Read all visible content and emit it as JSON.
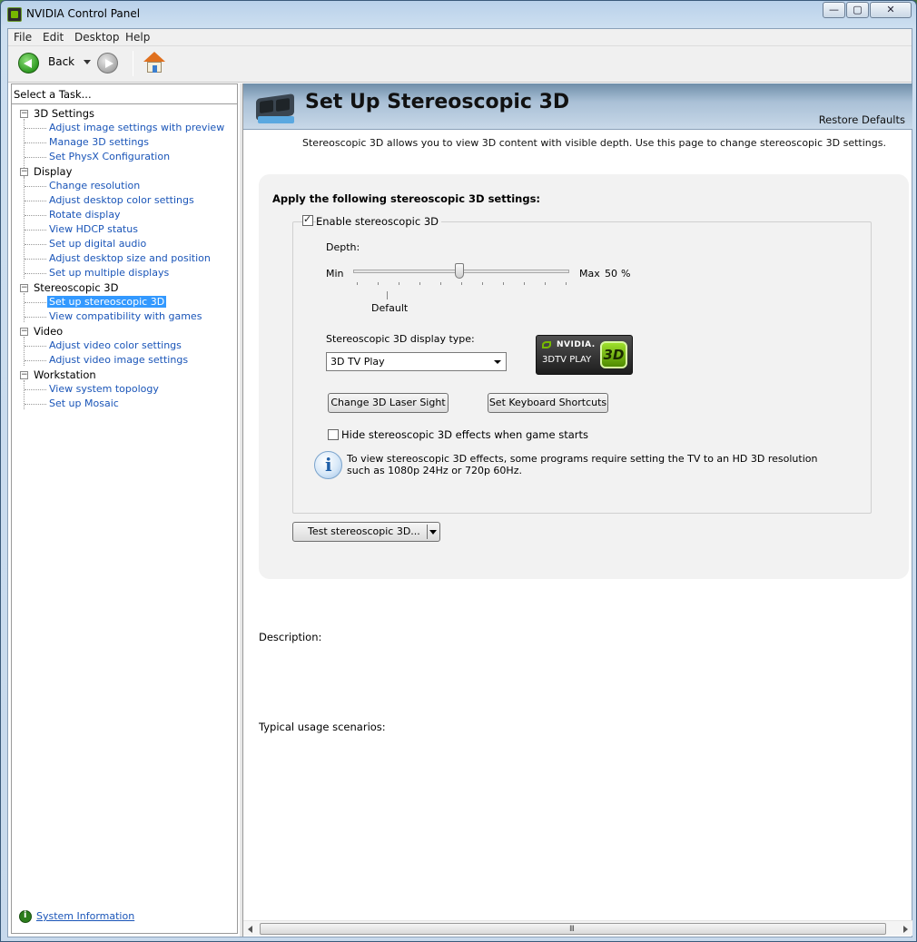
{
  "window": {
    "title": "NVIDIA Control Panel",
    "controls": {
      "minimize": "—",
      "maximize": "▢",
      "close": "✕"
    }
  },
  "menubar": {
    "items": [
      "File",
      "Edit",
      "Desktop",
      "Help"
    ]
  },
  "toolbar": {
    "back_label": "Back"
  },
  "left_panel": {
    "header": "Select a Task...",
    "tree": [
      {
        "category": "3D Settings",
        "items": [
          "Adjust image settings with preview",
          "Manage 3D settings",
          "Set PhysX Configuration"
        ]
      },
      {
        "category": "Display",
        "items": [
          "Change resolution",
          "Adjust desktop color settings",
          "Rotate display",
          "View HDCP status",
          "Set up digital audio",
          "Adjust desktop size and position",
          "Set up multiple displays"
        ]
      },
      {
        "category": "Stereoscopic 3D",
        "items": [
          "Set up stereoscopic 3D",
          "View compatibility with games"
        ]
      },
      {
        "category": "Video",
        "items": [
          "Adjust video color settings",
          "Adjust video image settings"
        ]
      },
      {
        "category": "Workstation",
        "items": [
          "View system topology",
          "Set up Mosaic"
        ]
      }
    ],
    "selected_item": "Set up stereoscopic 3D",
    "system_info": "System Information"
  },
  "page": {
    "title": "Set Up Stereoscopic 3D",
    "restore_defaults": "Restore Defaults",
    "description": "Stereoscopic 3D allows you to view 3D content with visible depth. Use this page to change stereoscopic 3D settings.",
    "apply_heading": "Apply the following stereoscopic 3D settings:",
    "enable_label": "Enable stereoscopic 3D",
    "enable_checked": true,
    "depth_label": "Depth:",
    "depth_min": "Min",
    "depth_max": "Max",
    "depth_value": "50",
    "depth_unit": "%",
    "depth_default": "Default",
    "display_type_label": "Stereoscopic 3D display type:",
    "display_type_value": "3D TV Play",
    "badge": {
      "brand": "NVIDIA.",
      "product": "3DTV PLAY",
      "mark": "3D"
    },
    "btn_laser": "Change 3D Laser Sight",
    "btn_keys": "Set Keyboard Shortcuts",
    "hide_label": "Hide stereoscopic 3D effects when game starts",
    "hide_checked": false,
    "info_text": "To view stereoscopic 3D effects, some programs require setting the TV to an HD 3D resolution such as 1080p 24Hz or 720p 60Hz.",
    "btn_test": "Test stereoscopic 3D...",
    "description_label": "Description:",
    "usage_label": "Typical usage scenarios:",
    "scroll_grip": "III"
  },
  "colors": {
    "link": "#1a55b8",
    "selection": "#3399ff",
    "nvidia_green": "#76b900"
  }
}
